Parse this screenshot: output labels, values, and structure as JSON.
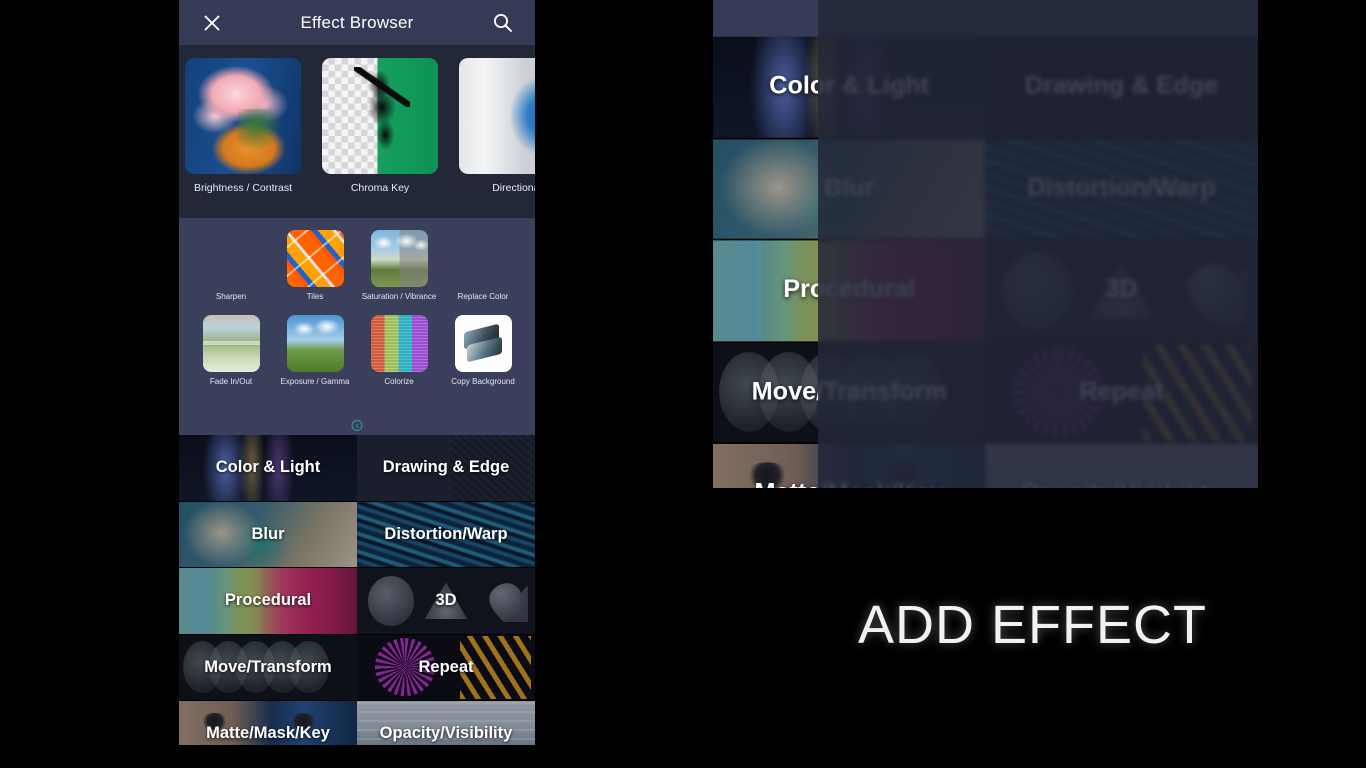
{
  "titlebar": {
    "title": "Effect Browser",
    "close_icon": "close-icon",
    "search_icon": "search-icon"
  },
  "effects_recent": {
    "row1": [
      {
        "label": "Brightness / Contrast",
        "art": "a-bright"
      },
      {
        "label": "Chroma Key",
        "art": "a-chroma"
      },
      {
        "label": "Directional",
        "art": "a-dir"
      }
    ],
    "row2": [
      {
        "label": "Sharpen",
        "art": "a-sharpen"
      },
      {
        "label": "Tiles",
        "art": "a-tiles"
      },
      {
        "label": "Saturation /\nVibrance",
        "art": "a-sat"
      },
      {
        "label": "Replace Color",
        "art": "a-replace"
      }
    ],
    "row3": [
      {
        "label": "Fade In/Out",
        "art": "a-fade"
      },
      {
        "label": "Exposure /\nGamma",
        "art": "a-exp"
      },
      {
        "label": "Colorize",
        "art": "a-colorize"
      },
      {
        "label": "Copy\nBackground",
        "art": "a-copy"
      }
    ],
    "recent_indicator_icon": "clock-icon",
    "recent_indicator_color": "#2a9d9a"
  },
  "categories": [
    {
      "label": "Color & Light",
      "art": "c-color"
    },
    {
      "label": "Drawing & Edge",
      "art": "c-draw"
    },
    {
      "label": "Blur",
      "art": "c-blur"
    },
    {
      "label": "Distortion/Warp",
      "art": "c-dist"
    },
    {
      "label": "Procedural",
      "art": "c-proc"
    },
    {
      "label": "3D",
      "art": "c-3d"
    },
    {
      "label": "Move/Transform",
      "art": "c-move"
    },
    {
      "label": "Repeat",
      "art": "c-repeat"
    },
    {
      "label": "Matte/Mask/Key",
      "art": "c-matte"
    },
    {
      "label": "Opacity/Visibility",
      "art": "c-opa"
    }
  ],
  "callout": {
    "text": "ADD EFFECT"
  },
  "colors": {
    "panel_bg": "#232838",
    "titlebar_bg": "#353b57",
    "grid_bg": "#3a3f5c",
    "stage_bg": "#000000",
    "label_text": "#ffffff",
    "accent": "#2a9d9a"
  }
}
